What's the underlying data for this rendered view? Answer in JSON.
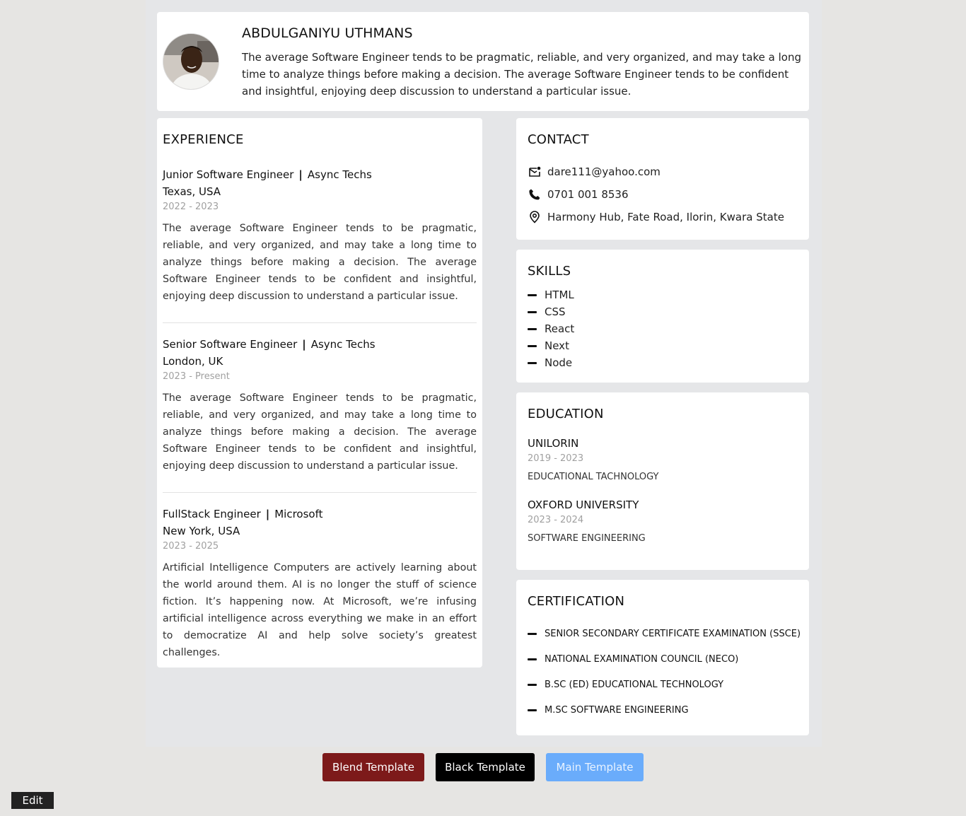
{
  "header": {
    "name": "ABDULGANIYU UTHMANS",
    "bio": "The average Software Engineer tends to be pragmatic, reliable, and very organized, and may take a long time to analyze things before making a decision. The average Software Engineer tends to be confident and insightful, enjoying deep discussion to understand a particular issue."
  },
  "experience": {
    "title": "EXPERIENCE",
    "items": [
      {
        "role": "Junior Software Engineer",
        "company": "Async Techs",
        "location": "Texas, USA",
        "dates": "2022 - 2023",
        "description": "The average Software Engineer tends to be pragmatic, reliable, and very organized, and may take a long time to analyze things before making a decision. The average Software Engineer tends to be confident and insightful, enjoying deep discussion to understand a particular issue."
      },
      {
        "role": "Senior Software Engineer",
        "company": "Async Techs",
        "location": "London, UK",
        "dates": "2023 - Present",
        "description": "The average Software Engineer tends to be pragmatic, reliable, and very organized, and may take a long time to analyze things before making a decision. The average Software Engineer tends to be confident and insightful, enjoying deep discussion to understand a particular issue."
      },
      {
        "role": "FullStack Engineer",
        "company": "Microsoft",
        "location": "New York, USA",
        "dates": "2023 - 2025",
        "description": "Artificial Intelligence Computers are actively learning about the world around them. AI is no longer the stuff of science fiction. It’s happening now. At Microsoft, we’re infusing artificial intelligence across everything we make in an effort to democratize AI and help solve society’s greatest challenges."
      }
    ],
    "separator": "|"
  },
  "contact": {
    "title": "CONTACT",
    "email": "dare111@yahoo.com",
    "phone": "0701 001 8536",
    "address": "Harmony Hub, Fate Road, Ilorin, Kwara State",
    "icons": [
      "mail-icon",
      "phone-icon",
      "location-pin-icon"
    ]
  },
  "skills": {
    "title": "SKILLS",
    "items": [
      "HTML",
      "CSS",
      "React",
      "Next",
      "Node"
    ]
  },
  "education": {
    "title": "EDUCATION",
    "items": [
      {
        "school": "UNILORIN",
        "dates": "2019 - 2023",
        "course": "EDUCATIONAL TACHNOLOGY"
      },
      {
        "school": "OXFORD UNIVERSITY",
        "dates": "2023 - 2024",
        "course": "SOFTWARE ENGINEERING"
      }
    ]
  },
  "certification": {
    "title": "CERTIFICATION",
    "items": [
      "SENIOR SECONDARY CERTIFICATE EXAMINATION (SSCE)",
      "NATIONAL EXAMINATION COUNCIL (NECO)",
      "B.SC (ED) EDUCATIONAL TECHNOLOGY",
      "M.SC SOFTWARE ENGINEERING"
    ]
  },
  "buttons": {
    "blend": "Blend Template",
    "black": "Black Template",
    "main": "Main Template",
    "edit": "Edit"
  },
  "colors": {
    "blend": "#7d1a1a",
    "black": "#000000",
    "main": "#6aacfb",
    "page_bg": "#e6e5e3",
    "sheet_bg": "#e5e6e8"
  }
}
